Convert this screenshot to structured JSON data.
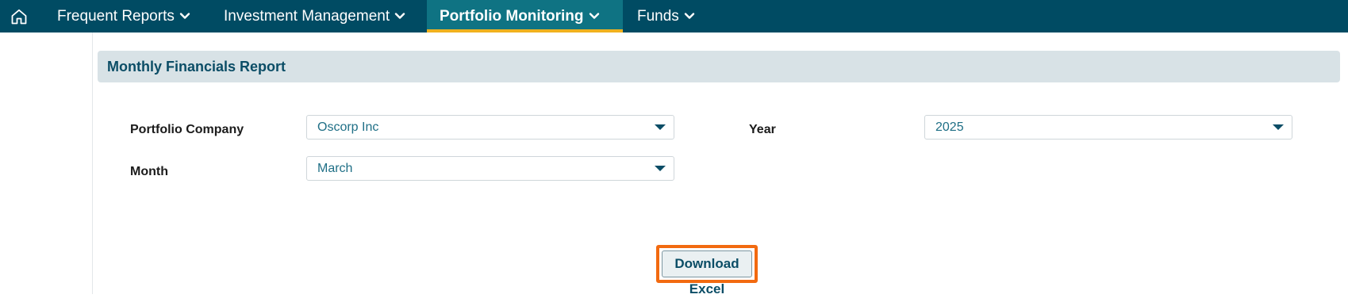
{
  "nav": {
    "home_icon": "home-icon",
    "items": [
      {
        "label": "Frequent Reports",
        "icon": "chevron-down-icon"
      },
      {
        "label": "Investment Management",
        "icon": "chevron-down-icon"
      },
      {
        "label": "Portfolio Monitoring",
        "icon": "chevron-down-icon",
        "active": true
      },
      {
        "label": "Funds",
        "icon": "chevron-down-icon"
      }
    ]
  },
  "report": {
    "title": "Monthly Financials Report",
    "fields": {
      "portfolio_company": {
        "label": "Portfolio Company",
        "value": "Oscorp Inc"
      },
      "year": {
        "label": "Year",
        "value": "2025"
      },
      "month": {
        "label": "Month",
        "value": "March"
      }
    },
    "download_label": "Download Excel"
  },
  "colors": {
    "nav_bg": "#004b63",
    "nav_active_bg": "#0f7383",
    "nav_active_underline": "#f0b11e",
    "panel_header_bg": "#d8e2e6",
    "title_text": "#0b4d66",
    "select_text": "#1f6f86",
    "highlight_border": "#f26a10"
  }
}
